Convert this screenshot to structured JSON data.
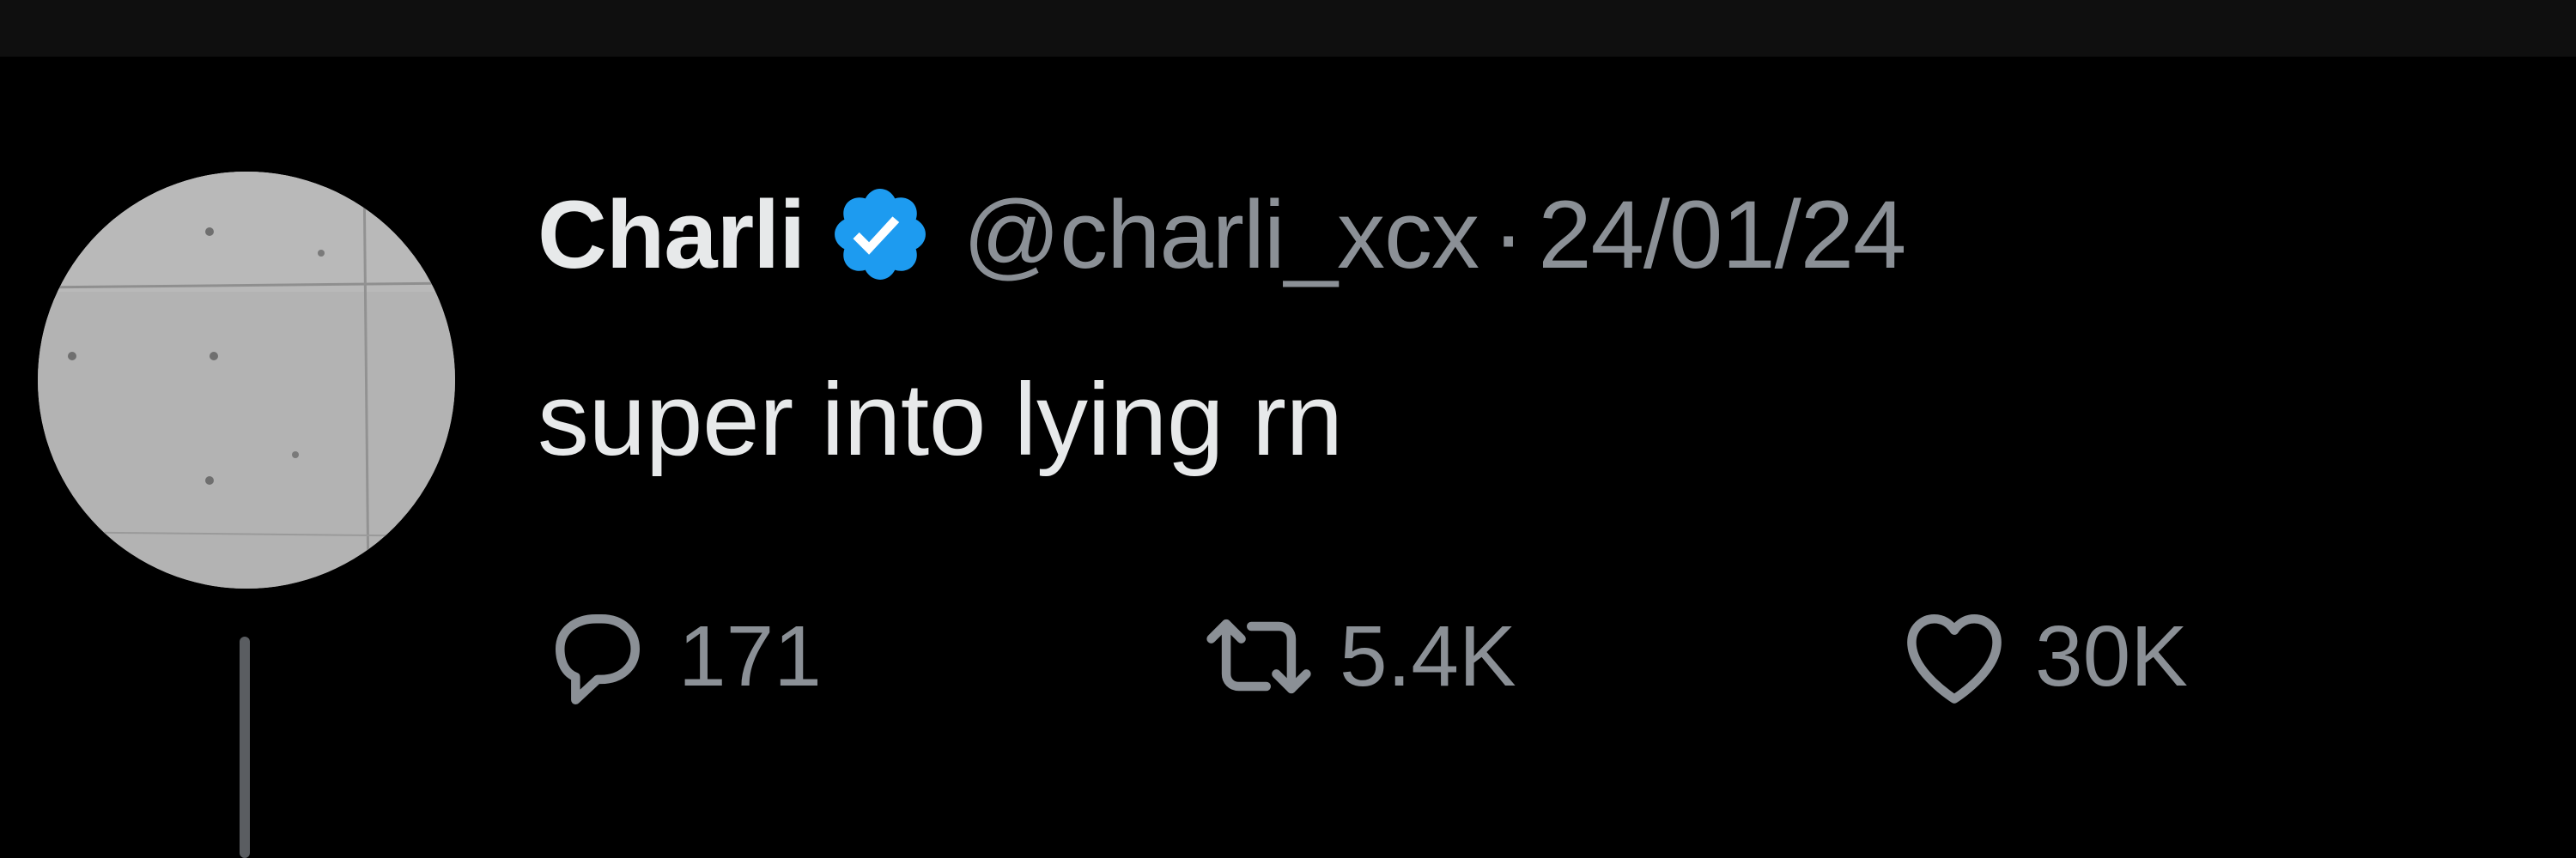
{
  "tweet": {
    "author_name": "Charli",
    "handle": "@charli_xcx",
    "separator": "·",
    "date": "24/01/24",
    "verified": true,
    "text": "super into lying rn"
  },
  "actions": {
    "replies": "171",
    "retweets": "5.4K",
    "likes": "30K"
  },
  "icons": {
    "reply": "speech-bubble-icon",
    "retweet": "retweet-icon",
    "like": "heart-icon",
    "verified": "verified-badge-icon"
  },
  "colors": {
    "background": "#000000",
    "primary_text": "#e7e9ea",
    "secondary_text": "#8b9096",
    "verified_blue": "#1d9bf0"
  }
}
